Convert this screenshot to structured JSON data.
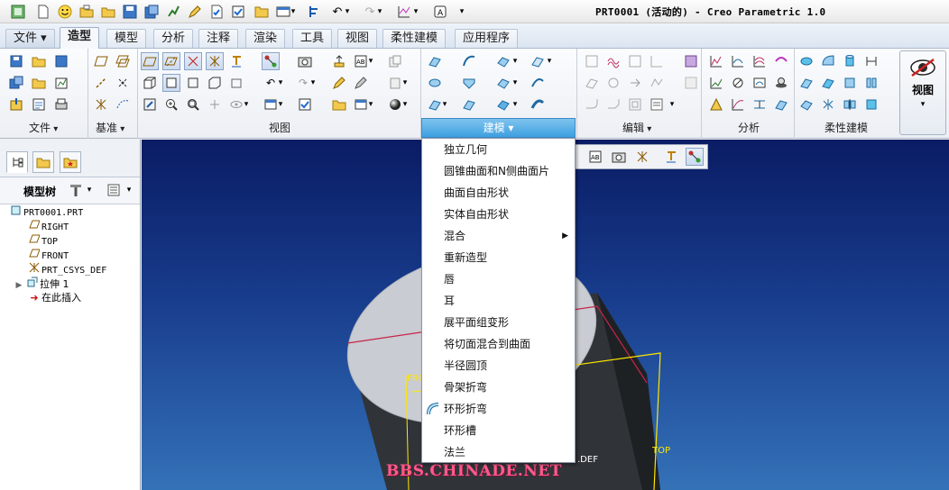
{
  "window": {
    "title": "PRT0001 (活动的) - Creo Parametric 1.0"
  },
  "quick_access": [
    "model-tree-icon",
    "new-icon",
    "smiley-icon",
    "open-icon",
    "folder-open-icon",
    "save-icon",
    "save-copy-icon",
    "regenerate-icon",
    "edit-icon",
    "checkbox-icon",
    "folder-icon",
    "window-icon",
    "dropdown-icon",
    "undo-icon",
    "dropdown-icon",
    "redo-icon",
    "dropdown-icon",
    "axes-icon",
    "dropdown-icon",
    "text-box-icon",
    "customize-icon"
  ],
  "tabs": [
    {
      "label": "文件 ▾",
      "active": false
    },
    {
      "label": "造型",
      "active": true
    },
    {
      "label": "模型",
      "active": false
    },
    {
      "label": "分析",
      "active": false
    },
    {
      "label": "注释",
      "active": false
    },
    {
      "label": "渲染",
      "active": false
    },
    {
      "label": "工具",
      "active": false
    },
    {
      "label": "视图",
      "active": false
    },
    {
      "label": "柔性建模",
      "active": false
    },
    {
      "label": "应用程序",
      "active": false
    }
  ],
  "ribbon": {
    "groups": [
      "文件",
      "基准",
      "视图",
      "建模",
      "编辑",
      "分析",
      "柔性建模"
    ],
    "view_button": "视图"
  },
  "modeling_menu": {
    "items": [
      {
        "label": "独立几何",
        "submenu": false,
        "icon": ""
      },
      {
        "label": "圆锥曲面和N侧曲面片",
        "submenu": false,
        "icon": ""
      },
      {
        "label": "曲面自由形状",
        "submenu": false,
        "icon": ""
      },
      {
        "label": "实体自由形状",
        "submenu": false,
        "icon": ""
      },
      {
        "label": "混合",
        "submenu": true,
        "icon": ""
      },
      {
        "label": "重新造型",
        "submenu": false,
        "icon": ""
      },
      {
        "label": "唇",
        "submenu": false,
        "icon": ""
      },
      {
        "label": "耳",
        "submenu": false,
        "icon": ""
      },
      {
        "label": "展平面组变形",
        "submenu": false,
        "icon": ""
      },
      {
        "label": "将切面混合到曲面",
        "submenu": false,
        "icon": ""
      },
      {
        "label": "半径圆顶",
        "submenu": false,
        "icon": ""
      },
      {
        "label": "骨架折弯",
        "submenu": false,
        "icon": ""
      },
      {
        "label": "环形折弯",
        "submenu": false,
        "icon": "toroidal-bend-icon"
      },
      {
        "label": "环形槽",
        "submenu": false,
        "icon": ""
      },
      {
        "label": "法兰",
        "submenu": false,
        "icon": ""
      }
    ]
  },
  "navigator": {
    "tree_title": "模型树",
    "nodes": [
      {
        "label": "PRT0001.PRT",
        "icon": "part-icon",
        "indent": 0,
        "expander": false
      },
      {
        "label": "RIGHT",
        "icon": "datum-plane-icon",
        "indent": 1,
        "expander": false
      },
      {
        "label": "TOP",
        "icon": "datum-plane-icon",
        "indent": 1,
        "expander": false
      },
      {
        "label": "FRONT",
        "icon": "datum-plane-icon",
        "indent": 1,
        "expander": false
      },
      {
        "label": "PRT_CSYS_DEF",
        "icon": "csys-icon",
        "indent": 1,
        "expander": false
      },
      {
        "label": "拉伸 1",
        "icon": "extrude-icon",
        "indent": 1,
        "expander": true
      },
      {
        "label": "在此插入",
        "icon": "insert-arrow-icon",
        "indent": 1,
        "expander": false
      }
    ]
  },
  "graphics": {
    "datum_labels": {
      "front": "FRO",
      "csys": ".DEF",
      "top": "TOP"
    },
    "watermark": "BBS.CHINADE.NET"
  },
  "colors": {
    "accent": "#3da0e0",
    "datum_plane": "#ffe600",
    "background_top": "#0a1c64",
    "background_bottom": "#3472b8"
  }
}
